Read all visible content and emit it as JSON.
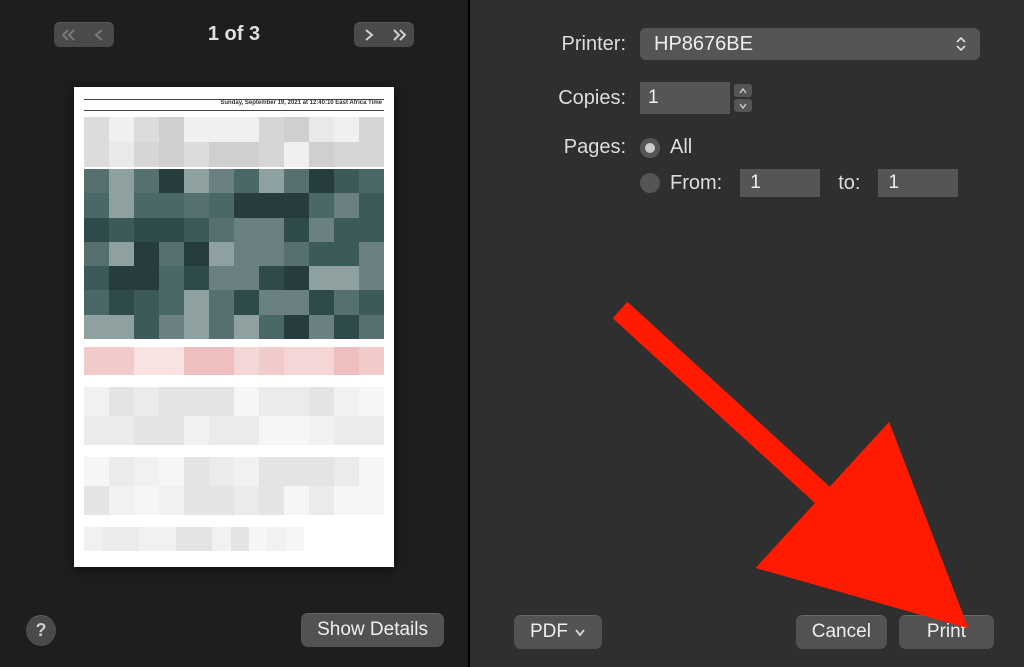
{
  "preview": {
    "page_indicator": "1 of 3",
    "doc_header_date": "Sunday, September 19, 2021 at 12:40:10 East Africa Time",
    "show_details_label": "Show Details"
  },
  "form": {
    "printer_label": "Printer:",
    "printer_value": "HP8676BE",
    "copies_label": "Copies:",
    "copies_value": "1",
    "pages_label": "Pages:",
    "pages_all_label": "All",
    "pages_from_label": "From:",
    "pages_from_value": "1",
    "pages_to_label": "to:",
    "pages_to_value": "1",
    "pages_selected": "all"
  },
  "footer": {
    "pdf_label": "PDF",
    "cancel_label": "Cancel",
    "print_label": "Print"
  },
  "help_symbol": "?"
}
